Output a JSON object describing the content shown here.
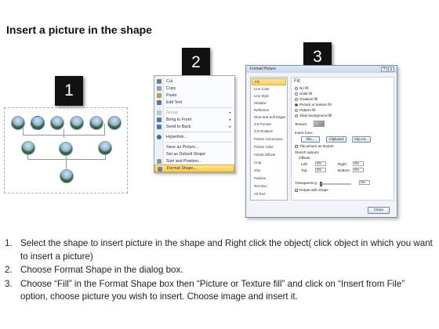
{
  "page": {
    "title": "Insert a picture in the shape"
  },
  "badges": [
    "1",
    "2",
    "3"
  ],
  "context_menu": {
    "items": [
      {
        "label": "Cut",
        "icon": "scissors-icon"
      },
      {
        "label": "Copy",
        "icon": "copy-icon"
      },
      {
        "label": "Paste",
        "icon": "paste-icon"
      },
      {
        "label": "Edit Text",
        "icon": "edit-text-icon"
      },
      {
        "label": "Group",
        "icon": "group-icon",
        "disabled": true,
        "submenu": true
      },
      {
        "label": "Bring to Front",
        "icon": "bring-front-icon",
        "submenu": true
      },
      {
        "label": "Send to Back",
        "icon": "send-back-icon",
        "submenu": true
      },
      {
        "label": "Hyperlink...",
        "icon": "hyperlink-icon"
      },
      {
        "label": "Save as Picture...",
        "icon": ""
      },
      {
        "label": "Set as Default Shape",
        "icon": ""
      },
      {
        "label": "Size and Position...",
        "icon": "size-position-icon"
      },
      {
        "label": "Format Shape...",
        "icon": "format-shape-icon",
        "highlighted": true
      }
    ]
  },
  "dialog": {
    "title": "Format Picture",
    "title_buttons": [
      "?",
      "x"
    ],
    "nav": [
      "Fill",
      "Line Color",
      "Line Style",
      "Shadow",
      "Reflection",
      "Glow and Soft Edges",
      "3-D Format",
      "3-D Rotation",
      "Picture Corrections",
      "Picture Color",
      "Artistic Effects",
      "Crop",
      "Size",
      "Position",
      "Text Box",
      "Alt Text"
    ],
    "selected_nav": "Fill",
    "section_heading": "Fill",
    "fill_options": [
      "No fill",
      "Solid fill",
      "Gradient fill",
      "Picture or texture fill",
      "Pattern fill",
      "Slide background fill"
    ],
    "selected_fill": "Picture or texture fill",
    "texture_label": "Texture:",
    "insert_from_label": "Insert from:",
    "insert_buttons": [
      "File...",
      "Clipboard",
      "Clip Art..."
    ],
    "tile_label": "Tile picture as texture",
    "stretch_label": "Stretch options",
    "offsets_label": "Offsets:",
    "offsets": [
      {
        "label": "Left:",
        "value": "0%"
      },
      {
        "label": "Right:",
        "value": "0%"
      },
      {
        "label": "Top:",
        "value": "0%"
      },
      {
        "label": "Bottom:",
        "value": "0%"
      }
    ],
    "transparency_label": "Transparency:",
    "transparency_value": "0%",
    "rotate_label": "Rotate with shape",
    "close_label": "Close"
  },
  "steps": [
    {
      "num": "1.",
      "text": "Select the shape to insert picture in the shape and Right click the object( click object in which you want to insert a picture)"
    },
    {
      "num": "2.",
      "text": "Choose Format Shape in the dialog box."
    },
    {
      "num": "3.",
      "text": "Choose “Fill” in the Format Shape box then “Picture or Texture fill”  and click on “Insert from File” option, choose picture you wish to insert. Choose image and insert it."
    }
  ]
}
